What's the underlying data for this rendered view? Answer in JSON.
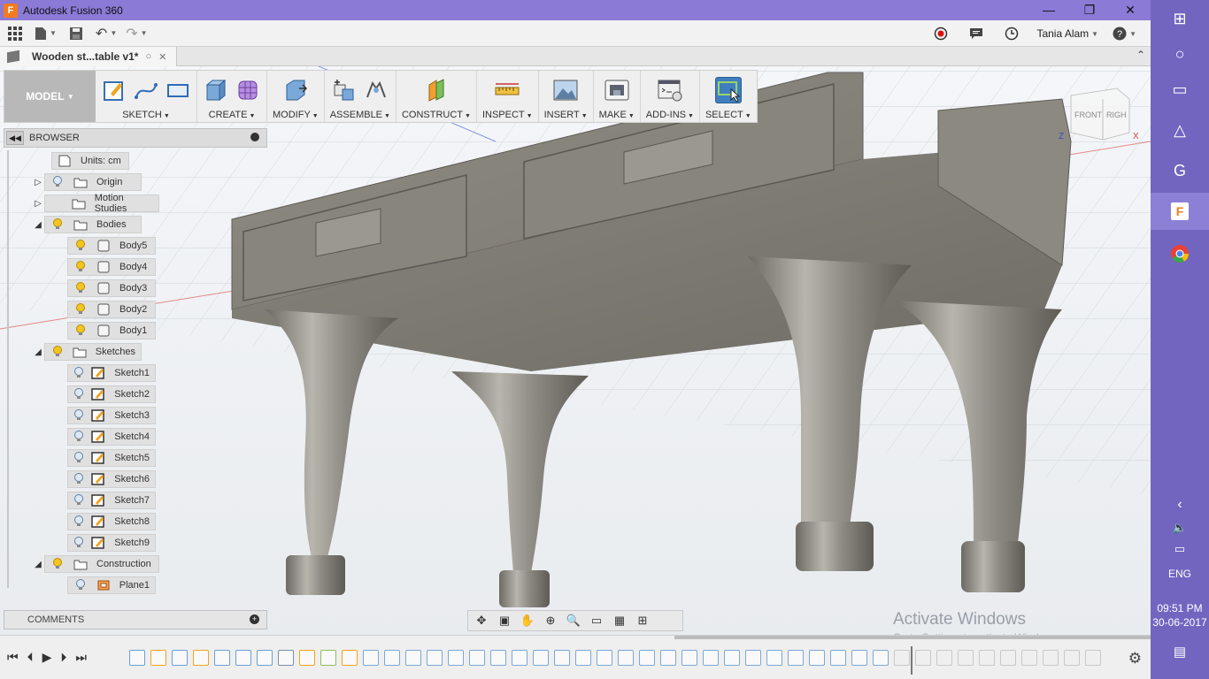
{
  "app": {
    "title": "Autodesk Fusion 360",
    "logo_letter": "F",
    "accent": "#8b7ad6"
  },
  "window_controls": [
    "minimize-icon",
    "restore-icon",
    "close-icon"
  ],
  "quick_access": {
    "user_name": "Tania Alam",
    "help_icon": "?"
  },
  "document": {
    "tab_name": "Wooden st...table v1*"
  },
  "toolbar": {
    "workspace": "MODEL",
    "groups": [
      {
        "label": "SKETCH",
        "icons": [
          "sketch-create-icon",
          "spline-icon",
          "rectangle-icon"
        ]
      },
      {
        "label": "CREATE",
        "icons": [
          "extrude-icon",
          "form-icon"
        ]
      },
      {
        "label": "MODIFY",
        "icons": [
          "press-pull-icon"
        ]
      },
      {
        "label": "ASSEMBLE",
        "icons": [
          "new-component-icon",
          "joint-icon"
        ]
      },
      {
        "label": "CONSTRUCT",
        "icons": [
          "offset-plane-icon"
        ]
      },
      {
        "label": "INSPECT",
        "icons": [
          "measure-icon"
        ]
      },
      {
        "label": "INSERT",
        "icons": [
          "insert-image-icon"
        ]
      },
      {
        "label": "MAKE",
        "icons": [
          "3d-print-icon"
        ]
      },
      {
        "label": "ADD-INS",
        "icons": [
          "scripts-icon"
        ]
      },
      {
        "label": "SELECT",
        "icons": [
          "select-icon"
        ]
      }
    ]
  },
  "browser": {
    "title": "BROWSER",
    "units": "Units: cm",
    "items": [
      {
        "label": "Origin",
        "indent": 0,
        "expand": "right",
        "type": "folder",
        "bulb": "off"
      },
      {
        "label": "Motion Studies",
        "indent": 0,
        "expand": "right",
        "type": "folder",
        "bulb": "none"
      },
      {
        "label": "Bodies",
        "indent": 0,
        "expand": "down",
        "type": "folder",
        "bulb": "on"
      },
      {
        "label": "Body5",
        "indent": 1,
        "type": "body",
        "bulb": "on"
      },
      {
        "label": "Body4",
        "indent": 1,
        "type": "body",
        "bulb": "on"
      },
      {
        "label": "Body3",
        "indent": 1,
        "type": "body",
        "bulb": "on"
      },
      {
        "label": "Body2",
        "indent": 1,
        "type": "body",
        "bulb": "on"
      },
      {
        "label": "Body1",
        "indent": 1,
        "type": "body",
        "bulb": "on"
      },
      {
        "label": "Sketches",
        "indent": 0,
        "expand": "down",
        "type": "folder",
        "bulb": "on"
      },
      {
        "label": "Sketch1",
        "indent": 1,
        "type": "sketch",
        "bulb": "off"
      },
      {
        "label": "Sketch2",
        "indent": 1,
        "type": "sketch",
        "bulb": "off"
      },
      {
        "label": "Sketch3",
        "indent": 1,
        "type": "sketch",
        "bulb": "off"
      },
      {
        "label": "Sketch4",
        "indent": 1,
        "type": "sketch",
        "bulb": "off"
      },
      {
        "label": "Sketch5",
        "indent": 1,
        "type": "sketch",
        "bulb": "off"
      },
      {
        "label": "Sketch6",
        "indent": 1,
        "type": "sketch",
        "bulb": "off"
      },
      {
        "label": "Sketch7",
        "indent": 1,
        "type": "sketch",
        "bulb": "off"
      },
      {
        "label": "Sketch8",
        "indent": 1,
        "type": "sketch",
        "bulb": "off"
      },
      {
        "label": "Sketch9",
        "indent": 1,
        "type": "sketch",
        "bulb": "off"
      },
      {
        "label": "Construction",
        "indent": 0,
        "expand": "down",
        "type": "folder",
        "bulb": "on"
      },
      {
        "label": "Plane1",
        "indent": 1,
        "type": "plane",
        "bulb": "off"
      }
    ]
  },
  "viewcube": {
    "front": "FRONT",
    "right": "RIGH",
    "axis_z": "Z",
    "axis_x": "X"
  },
  "comments": {
    "title": "COMMENTS"
  },
  "watermark": {
    "line1": "Activate Windows",
    "line2": "Go to Settings to activate Windows."
  },
  "taskbar": {
    "language": "ENG",
    "time": "09:51 PM",
    "date": "30-06-2017",
    "color": "#7265c0"
  }
}
